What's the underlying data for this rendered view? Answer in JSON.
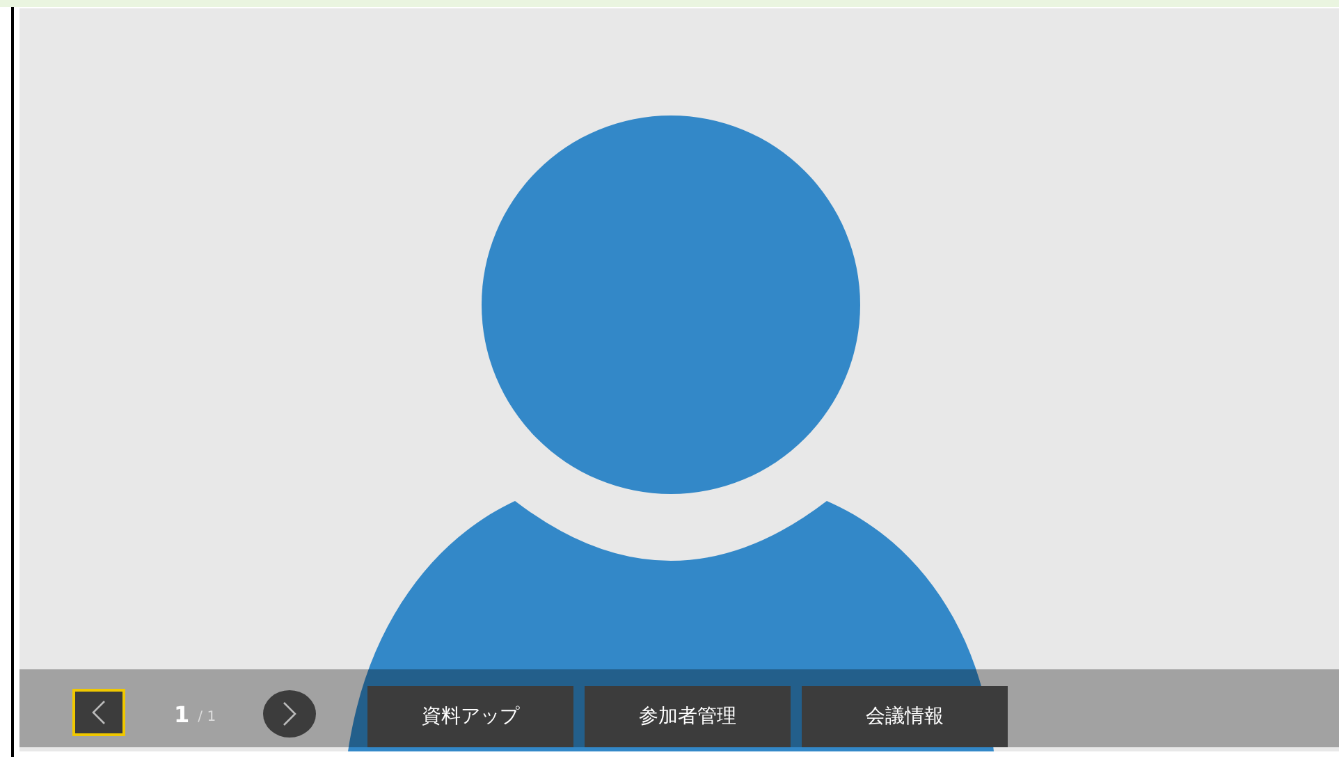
{
  "video": {
    "kind": "avatar"
  },
  "pager": {
    "prev_focused": true,
    "current": "1",
    "total": "/ 1"
  },
  "buttons": [
    {
      "label": "資料アップ"
    },
    {
      "label": "参加者管理"
    },
    {
      "label": "会議情報"
    }
  ]
}
